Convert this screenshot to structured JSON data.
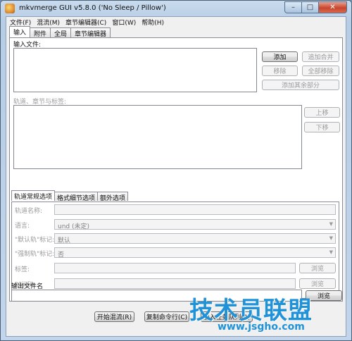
{
  "window": {
    "title": "mkvmerge GUI v5.8.0 ('No Sleep / Pillow')",
    "caption_min": "–",
    "caption_max": "□",
    "caption_close": "✕"
  },
  "menu": [
    "文件(F)",
    "混流(M)",
    "章节编辑器(C)",
    "窗口(W)",
    "帮助(H)"
  ],
  "tabs": [
    "输入",
    "附件",
    "全局",
    "章节编辑器"
  ],
  "input": {
    "input_files_label": "输入文件:",
    "add": "添加",
    "append": "追加合并",
    "remove": "移除",
    "remove_all": "全部移除",
    "add_other_parts": "添加其余部分",
    "tracks_label": "轨道、章节与标签:",
    "move_up": "上移",
    "move_down": "下移"
  },
  "subtabs": [
    "轨道常规选项",
    "格式细节选项",
    "额外选项"
  ],
  "track_options": {
    "track_name_label": "轨道名称:",
    "language_label": "语言:",
    "language_value": "und (未定)",
    "default_track_label": "\"默认轨\"标记:",
    "default_track_value": "默认",
    "forced_track_label": "\"强制轨\"标记:",
    "forced_track_value": "否",
    "tags_label": "标签:",
    "timecodes_label": "时间码:",
    "browse": "浏览"
  },
  "output": {
    "label": "输出文件名",
    "browse": "浏览"
  },
  "bottom": {
    "start_muxing": "开始混流(R)",
    "copy_command": "复制命令行(C)",
    "add_to_queue": "加入任务队列(A)"
  },
  "watermark": {
    "text": "技术员联盟",
    "url": "www.jsgho.com"
  }
}
